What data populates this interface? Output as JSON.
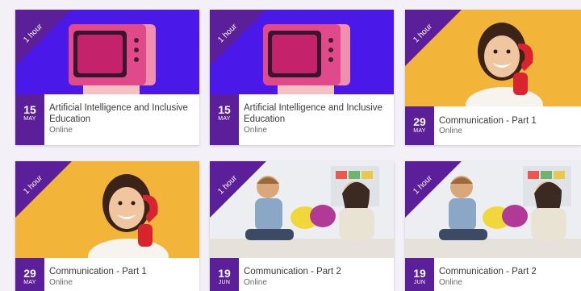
{
  "cards": [
    {
      "duration": "1 hour",
      "day": "15",
      "month": "MAY",
      "title": "Artificial Intelligence and Inclusive Education",
      "location": "Online"
    },
    {
      "duration": "1 hour",
      "day": "15",
      "month": "MAY",
      "title": "Artificial Intelligence and Inclusive Education",
      "location": "Online"
    },
    {
      "duration": "1 hour",
      "day": "29",
      "month": "MAY",
      "title": "Communication - Part 1",
      "location": "Online"
    },
    {
      "duration": "1 hour",
      "day": "29",
      "month": "MAY",
      "title": "Communication - Part 1",
      "location": "Online"
    },
    {
      "duration": "1 hour",
      "day": "19",
      "month": "JUN",
      "title": "Communication - Part 2",
      "location": "Online"
    },
    {
      "duration": "1 hour",
      "day": "19",
      "month": "JUN",
      "title": "Communication - Part 2",
      "location": "Online"
    }
  ],
  "colors": {
    "accent": "#5b1f9a",
    "tv_bg": "#4a18e8",
    "phone_bg": "#f3b43a"
  }
}
